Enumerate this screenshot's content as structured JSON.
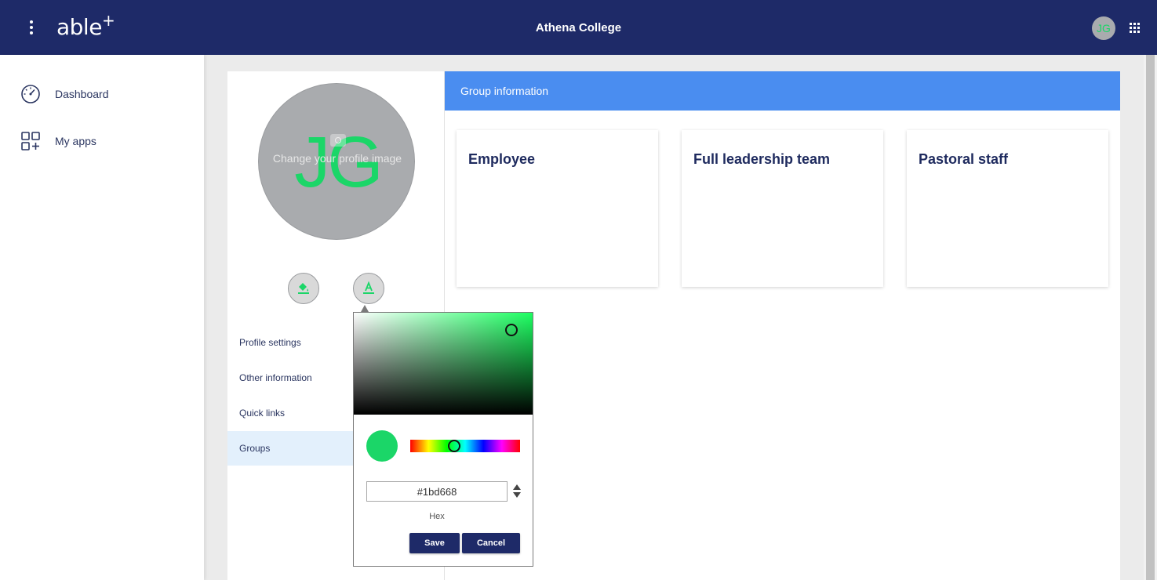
{
  "header": {
    "logo_text": "able",
    "logo_plus": "+",
    "title": "Athena College",
    "user_initials": "JG"
  },
  "sidebar": {
    "items": [
      {
        "label": "Dashboard",
        "icon": "dashboard-gauge-icon"
      },
      {
        "label": "My apps",
        "icon": "apps-add-icon"
      }
    ]
  },
  "profile": {
    "initials": "JG",
    "change_image_text": "Change your profile image",
    "initials_color": "#1bd668",
    "avatar_bg_color": "#a9abae",
    "menu": [
      {
        "label": "Profile settings",
        "active": false
      },
      {
        "label": "Other information",
        "active": false
      },
      {
        "label": "Quick links",
        "active": false
      },
      {
        "label": "Groups",
        "active": true
      }
    ]
  },
  "groups": {
    "header": "Group information",
    "items": [
      {
        "name": "Employee"
      },
      {
        "name": "Full leadership team"
      },
      {
        "name": "Pastoral staff"
      }
    ]
  },
  "color_picker": {
    "hex_value": "#1bd668",
    "mode_label": "Hex",
    "save_label": "Save",
    "cancel_label": "Cancel"
  },
  "colors": {
    "header_bg": "#1e2a68",
    "group_header_bg": "#4a8df0",
    "accent_green": "#1bd668",
    "active_menu_bg": "#e3f0fc"
  }
}
